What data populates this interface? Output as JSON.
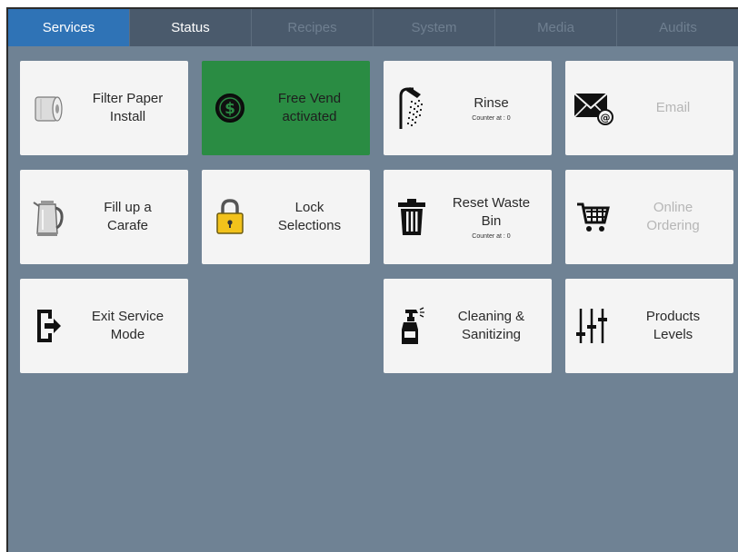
{
  "tabs": [
    {
      "label": "Services",
      "state": "active"
    },
    {
      "label": "Status",
      "state": "enabled"
    },
    {
      "label": "Recipes",
      "state": "disabled"
    },
    {
      "label": "System",
      "state": "disabled"
    },
    {
      "label": "Media",
      "state": "disabled"
    },
    {
      "label": "Audits",
      "state": "disabled"
    }
  ],
  "tiles": {
    "filter_paper": {
      "label": "Filter Paper\nInstall",
      "icon": "filter-paper-roll-icon"
    },
    "free_vend": {
      "label": "Free Vend\nactivated",
      "icon": "dollar-coin-icon"
    },
    "rinse": {
      "label": "Rinse",
      "sub": "Counter at : 0",
      "icon": "shower-icon"
    },
    "email": {
      "label": "Email",
      "icon": "email-icon"
    },
    "fill_carafe": {
      "label": "Fill up a\nCarafe",
      "icon": "kettle-icon"
    },
    "lock_selections": {
      "label": "Lock\nSelections",
      "icon": "padlock-icon"
    },
    "reset_waste_bin": {
      "label": "Reset Waste\nBin",
      "sub": "Counter at : 0",
      "icon": "trash-bin-icon"
    },
    "online_ordering": {
      "label": "Online\nOrdering",
      "icon": "shopping-cart-icon"
    },
    "exit_service_mode": {
      "label": "Exit Service\nMode",
      "icon": "exit-door-icon"
    },
    "cleaning": {
      "label": "Cleaning &\nSanitizing",
      "icon": "spray-bottle-icon"
    },
    "products_levels": {
      "label": "Products\nLevels",
      "icon": "level-sliders-icon"
    }
  },
  "colors": {
    "background": "#6f8294",
    "tab_active": "#2f73b6",
    "tile_active_green": "#2a8c43",
    "tile": "#f4f4f4"
  }
}
